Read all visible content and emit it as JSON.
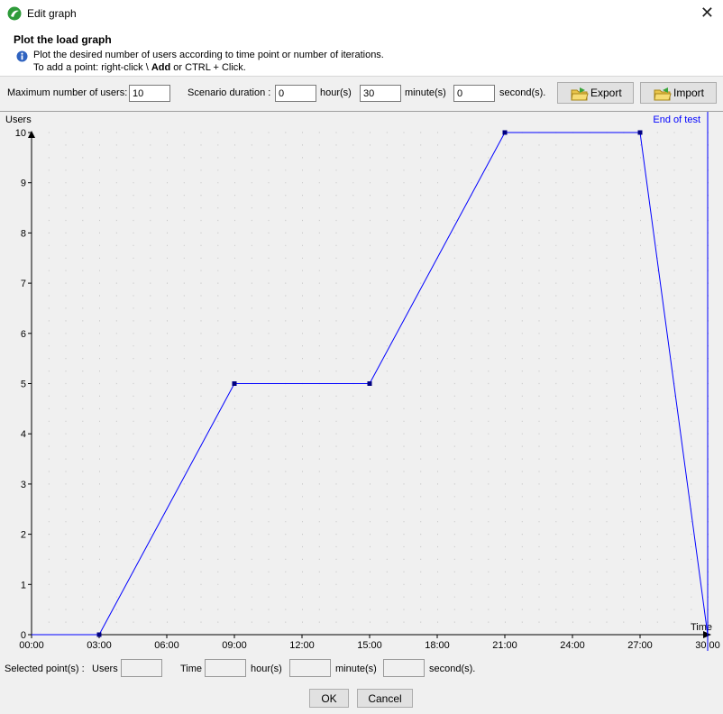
{
  "window": {
    "title": "Edit graph",
    "close_glyph": "✕"
  },
  "header": {
    "title": "Plot the load graph",
    "info_line1": "Plot the desired number of users according to time point or number of iterations.",
    "info_line2_prefix": "To add a point: right-click \\ ",
    "info_line2_bold": "Add",
    "info_line2_suffix": " or CTRL + Click."
  },
  "toolbar": {
    "max_users_label": "Maximum number of users:",
    "max_users_value": "10",
    "duration_label": "Scenario duration :",
    "hours_value": "0",
    "hours_label": "hour(s)",
    "minutes_value": "30",
    "minutes_label": "minute(s)",
    "seconds_value": "0",
    "seconds_label": "second(s).",
    "export_label": "Export",
    "import_label": "Import"
  },
  "chart_data": {
    "type": "line",
    "ylabel": "Users",
    "xlabel": "Time",
    "end_marker_label": "End of test",
    "ylim": [
      0,
      10
    ],
    "xlim_minutes": [
      0,
      30
    ],
    "y_ticks": [
      0,
      1,
      2,
      3,
      4,
      5,
      6,
      7,
      8,
      9,
      10
    ],
    "x_ticks": [
      "00:00",
      "03:00",
      "06:00",
      "09:00",
      "12:00",
      "15:00",
      "18:00",
      "21:00",
      "24:00",
      "27:00",
      "30:00"
    ],
    "x_tick_minutes": [
      0,
      3,
      6,
      9,
      12,
      15,
      18,
      21,
      24,
      27,
      30
    ],
    "series": [
      {
        "points": [
          {
            "x": "00:00",
            "minutes": 0,
            "y": 0
          },
          {
            "x": "03:00",
            "minutes": 3,
            "y": 0
          },
          {
            "x": "09:00",
            "minutes": 9,
            "y": 5
          },
          {
            "x": "15:00",
            "minutes": 15,
            "y": 5
          },
          {
            "x": "21:00",
            "minutes": 21,
            "y": 10
          },
          {
            "x": "27:00",
            "minutes": 27,
            "y": 10
          },
          {
            "x": "30:00",
            "minutes": 30,
            "y": 0
          }
        ],
        "marker_minutes": [
          3,
          9,
          15,
          21,
          27
        ]
      }
    ],
    "grid": "dotted",
    "colors": {
      "line": "#0000ff",
      "marker": "#000080",
      "axis": "#000000",
      "grid": "#c8c8c8",
      "end_line": "#0000ff"
    }
  },
  "selected": {
    "label": "Selected point(s) :",
    "users_label": "Users",
    "time_label": "Time",
    "hours_label": "hour(s)",
    "minutes_label": "minute(s)",
    "seconds_label": "second(s)."
  },
  "buttons": {
    "ok": "OK",
    "cancel": "Cancel"
  }
}
